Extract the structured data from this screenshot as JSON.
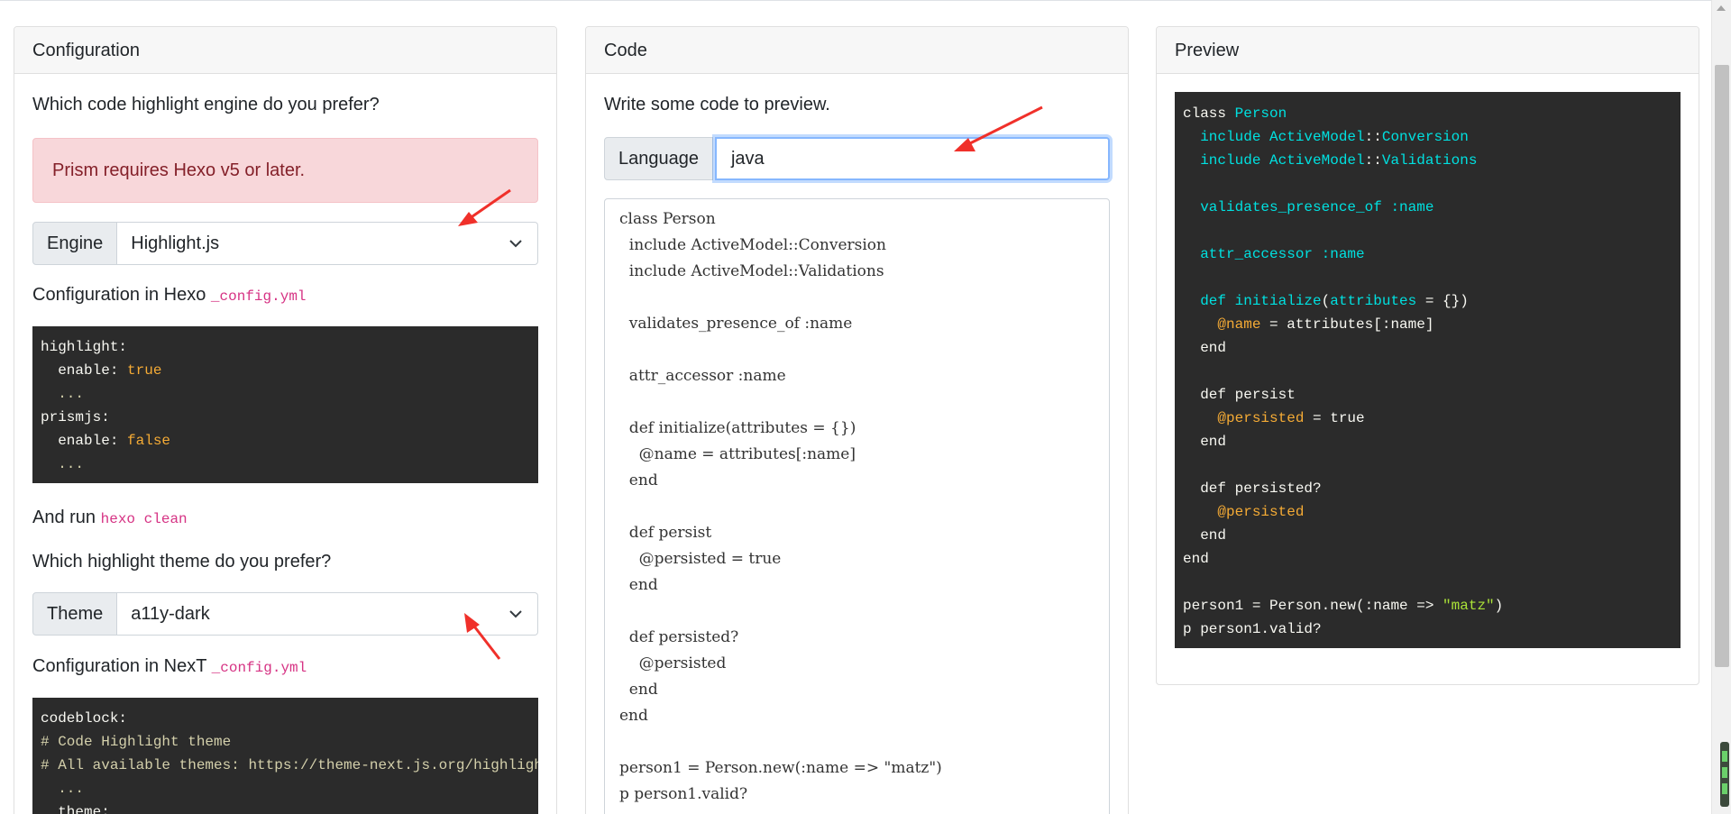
{
  "colors": {
    "accent_red": "#f0302a",
    "dark_bg": "#2b2b2b",
    "focus_border": "#86b7fe"
  },
  "configuration": {
    "header": "Configuration",
    "q_engine": "Which code highlight engine do you prefer?",
    "alert": "Prism requires Hexo v5 or later.",
    "engine_label": "Engine",
    "engine_value": "Highlight.js",
    "hexo_config_prefix": "Configuration in Hexo",
    "hexo_config_file": "_config.yml",
    "hexo_lines": [
      [
        {
          "t": "highlight:",
          "c": ""
        }
      ],
      [
        {
          "t": "  enable: ",
          "c": ""
        },
        {
          "t": "true",
          "c": "k-or"
        }
      ],
      [
        {
          "t": "  ...",
          "c": "k-grey"
        }
      ],
      [
        {
          "t": "prismjs:",
          "c": ""
        }
      ],
      [
        {
          "t": "  enable: ",
          "c": ""
        },
        {
          "t": "false",
          "c": "k-or"
        }
      ],
      [
        {
          "t": "  ...",
          "c": "k-grey"
        }
      ]
    ],
    "run_prefix": "And run",
    "run_cmd": "hexo clean",
    "q_theme": "Which highlight theme do you prefer?",
    "theme_label": "Theme",
    "theme_value": "a11y-dark",
    "next_config_prefix": "Configuration in NexT",
    "next_config_file": "_config.yml",
    "next_lines": [
      [
        {
          "t": "codeblock:",
          "c": ""
        }
      ],
      [
        {
          "t": "# Code Highlight theme",
          "c": "k-yl"
        }
      ],
      [
        {
          "t": "# All available themes: https://theme-next.js.org/highlight/",
          "c": "k-yl"
        }
      ],
      [
        {
          "t": "  ...",
          "c": "k-grey"
        }
      ],
      [
        {
          "t": "  theme:",
          "c": ""
        }
      ]
    ]
  },
  "code": {
    "header": "Code",
    "prompt": "Write some code to preview.",
    "language_label": "Language",
    "language_value": "java",
    "lines": [
      "class Person",
      "  include ActiveModel::Conversion",
      "  include ActiveModel::Validations",
      "",
      "  validates_presence_of :name",
      "",
      "  attr_accessor :name",
      "",
      "  def initialize(attributes = {})",
      "    @name = attributes[:name]",
      "  end",
      "",
      "  def persist",
      "    @persisted = true",
      "  end",
      "",
      "  def persisted?",
      "    @persisted",
      "  end",
      "end",
      "",
      "person1 = Person.new(:name => \"matz\")",
      "p person1.valid?"
    ]
  },
  "preview": {
    "header": "Preview",
    "lines": [
      [
        {
          "t": "class ",
          "c": ""
        },
        {
          "t": "Person",
          "c": "k-cy"
        }
      ],
      [
        {
          "t": "  include ",
          "c": "k-cy"
        },
        {
          "t": "ActiveModel",
          "c": "k-cy"
        },
        {
          "t": "::",
          "c": ""
        },
        {
          "t": "Conversion",
          "c": "k-cy"
        }
      ],
      [
        {
          "t": "  include ",
          "c": "k-cy"
        },
        {
          "t": "ActiveModel",
          "c": "k-cy"
        },
        {
          "t": "::",
          "c": ""
        },
        {
          "t": "Validations",
          "c": "k-cy"
        }
      ],
      [
        {
          "t": "",
          "c": ""
        }
      ],
      [
        {
          "t": "  validates_presence_of ",
          "c": "k-cy"
        },
        {
          "t": ":name",
          "c": "k-cy"
        }
      ],
      [
        {
          "t": "",
          "c": ""
        }
      ],
      [
        {
          "t": "  attr_accessor ",
          "c": "k-cy"
        },
        {
          "t": ":name",
          "c": "k-cy"
        }
      ],
      [
        {
          "t": "",
          "c": ""
        }
      ],
      [
        {
          "t": "  def ",
          "c": "k-cy"
        },
        {
          "t": "initialize",
          "c": "k-cy"
        },
        {
          "t": "(",
          "c": ""
        },
        {
          "t": "attributes",
          "c": "k-cy"
        },
        {
          "t": " = {})",
          "c": ""
        }
      ],
      [
        {
          "t": "    ",
          "c": ""
        },
        {
          "t": "@name",
          "c": "k-or"
        },
        {
          "t": " = attributes[:name]",
          "c": ""
        }
      ],
      [
        {
          "t": "  end",
          "c": ""
        }
      ],
      [
        {
          "t": "",
          "c": ""
        }
      ],
      [
        {
          "t": "  def persist",
          "c": ""
        }
      ],
      [
        {
          "t": "    ",
          "c": ""
        },
        {
          "t": "@persisted",
          "c": "k-or"
        },
        {
          "t": " = true",
          "c": ""
        }
      ],
      [
        {
          "t": "  end",
          "c": ""
        }
      ],
      [
        {
          "t": "",
          "c": ""
        }
      ],
      [
        {
          "t": "  def persisted?",
          "c": ""
        }
      ],
      [
        {
          "t": "    ",
          "c": ""
        },
        {
          "t": "@persisted",
          "c": "k-or"
        }
      ],
      [
        {
          "t": "  end",
          "c": ""
        }
      ],
      [
        {
          "t": "end",
          "c": ""
        }
      ],
      [
        {
          "t": "",
          "c": ""
        }
      ],
      [
        {
          "t": "person1 = Person.new(:name => ",
          "c": ""
        },
        {
          "t": "\"matz\"",
          "c": "k-gn"
        },
        {
          "t": ")",
          "c": ""
        }
      ],
      [
        {
          "t": "p person1.valid?",
          "c": ""
        }
      ]
    ]
  }
}
